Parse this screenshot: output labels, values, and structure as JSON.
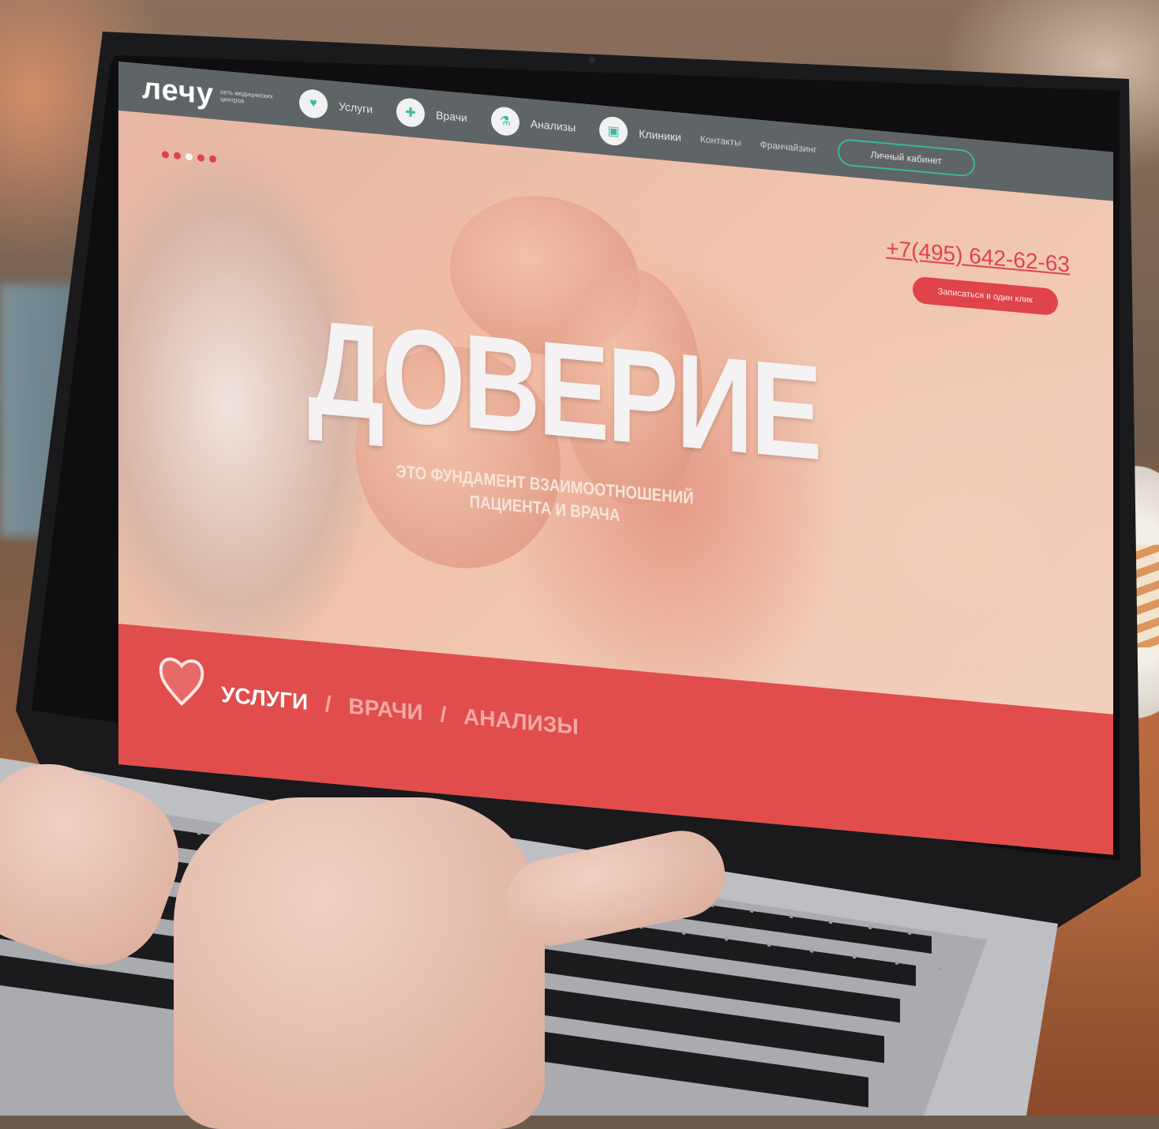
{
  "site": {
    "logo": "лечу",
    "logo_subtitle": "сеть медицинских центров",
    "nav": [
      {
        "label": "Услуги",
        "icon": "heart-icon"
      },
      {
        "label": "Врачи",
        "icon": "doctor-icon"
      },
      {
        "label": "Анализы",
        "icon": "microscope-icon"
      },
      {
        "label": "Клиники",
        "icon": "clinic-icon"
      }
    ],
    "links": [
      "Контакты",
      "Франчайзинг"
    ],
    "cabinet_label": "Личный кабинет",
    "phone": "+7(495) 642-62-63",
    "book_label": "Записаться в один клик",
    "headline": "ДОВЕРИЕ",
    "subline_1": "ЭТО ФУНДАМЕНТ ВЗАИМООТНОШЕНИЙ",
    "subline_2": "ПАЦИЕНТА И ВРАЧА",
    "tabs": {
      "active": "УСЛУГИ",
      "second": "ВРАЧИ",
      "third": "АНАЛИЗЫ",
      "separator": "/"
    },
    "slider": {
      "count": 5,
      "active_index": 2
    }
  },
  "colors": {
    "accent_red": "#e0434a",
    "accent_teal": "#36b89f",
    "nav_bg": "#5f6466"
  }
}
